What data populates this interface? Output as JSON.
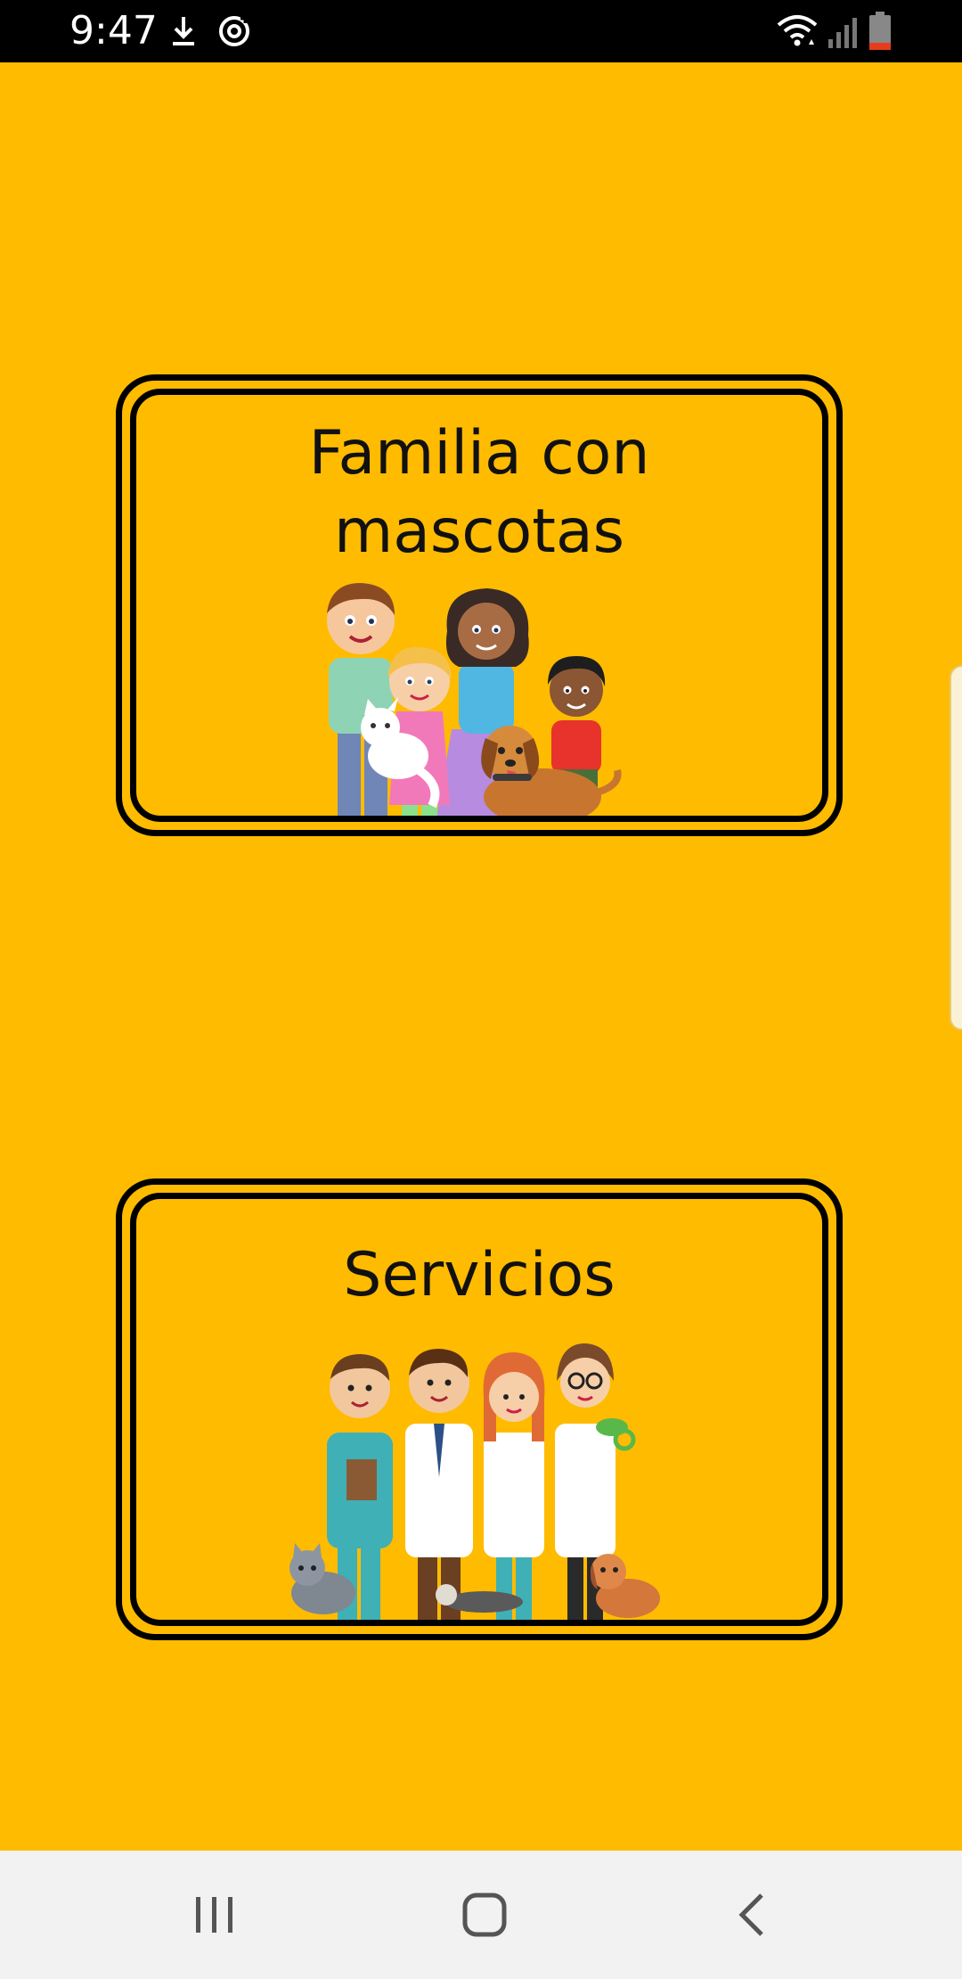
{
  "status_bar": {
    "time": "9:47",
    "icons": [
      "download-icon",
      "sync-icon",
      "wifi-icon",
      "signal-icon",
      "battery-icon"
    ]
  },
  "cards": [
    {
      "title_line1": "Familia con",
      "title_line2": "mascotas",
      "illustration": "family-with-pets-illustration"
    },
    {
      "title": "Servicios",
      "illustration": "veterinary-staff-illustration"
    }
  ],
  "colors": {
    "background": "#FFBB00",
    "border": "#000000",
    "nav_bar": "#F2F2F2"
  },
  "nav_bar": {
    "buttons": [
      "recent-apps-icon",
      "home-icon",
      "back-icon"
    ]
  }
}
